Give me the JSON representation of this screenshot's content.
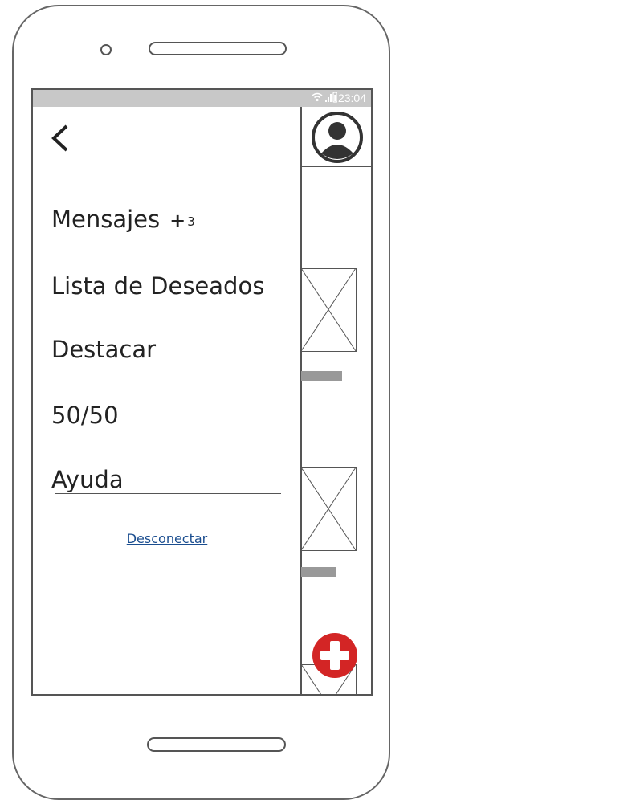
{
  "status_bar": {
    "icons": [
      "wifi-icon",
      "signal-icon",
      "battery-icon"
    ],
    "time": "23:04"
  },
  "drawer": {
    "back_icon": "chevron-left-icon",
    "items": [
      {
        "label": "Mensajes",
        "badge_symbol": "+",
        "badge_count": "3"
      },
      {
        "label": "Lista de Deseados"
      },
      {
        "label": "Destacar"
      },
      {
        "label": "50/50"
      },
      {
        "label": "Ayuda"
      }
    ],
    "logout_label": "Desconectar"
  },
  "background": {
    "avatar_icon": "user-avatar-icon",
    "fab_icon": "plus-circle-icon"
  },
  "colors": {
    "fab": "#d32525",
    "link": "#1a4d8f",
    "status_bar": "#c8c8c8"
  }
}
